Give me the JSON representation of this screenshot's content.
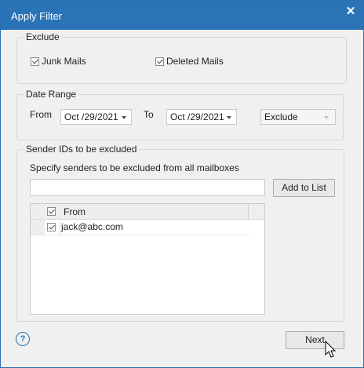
{
  "dialog": {
    "title": "Apply Filter",
    "close_glyph": "✕"
  },
  "exclude": {
    "legend": "Exclude",
    "junk_mails": {
      "label": "Junk Mails",
      "checked": true
    },
    "deleted_mails": {
      "label": "Deleted Mails",
      "checked": true
    }
  },
  "date_range": {
    "legend": "Date Range",
    "from_label": "From",
    "from_value": "Oct /29/2021",
    "to_label": "To",
    "to_value": "Oct /29/2021",
    "mode_value": "Exclude"
  },
  "senders": {
    "legend": "Sender IDs to be excluded",
    "instructions": "Specify senders to be excluded from all mailboxes",
    "input_value": "",
    "add_button": "Add to List",
    "column_header": "From",
    "rows": [
      {
        "email": "jack@abc.com",
        "checked": true
      }
    ]
  },
  "footer": {
    "help_glyph": "?",
    "next_button": "Next"
  },
  "colors": {
    "titlebar": "#2b73b7",
    "dialog_bg": "#f0f0f0"
  }
}
